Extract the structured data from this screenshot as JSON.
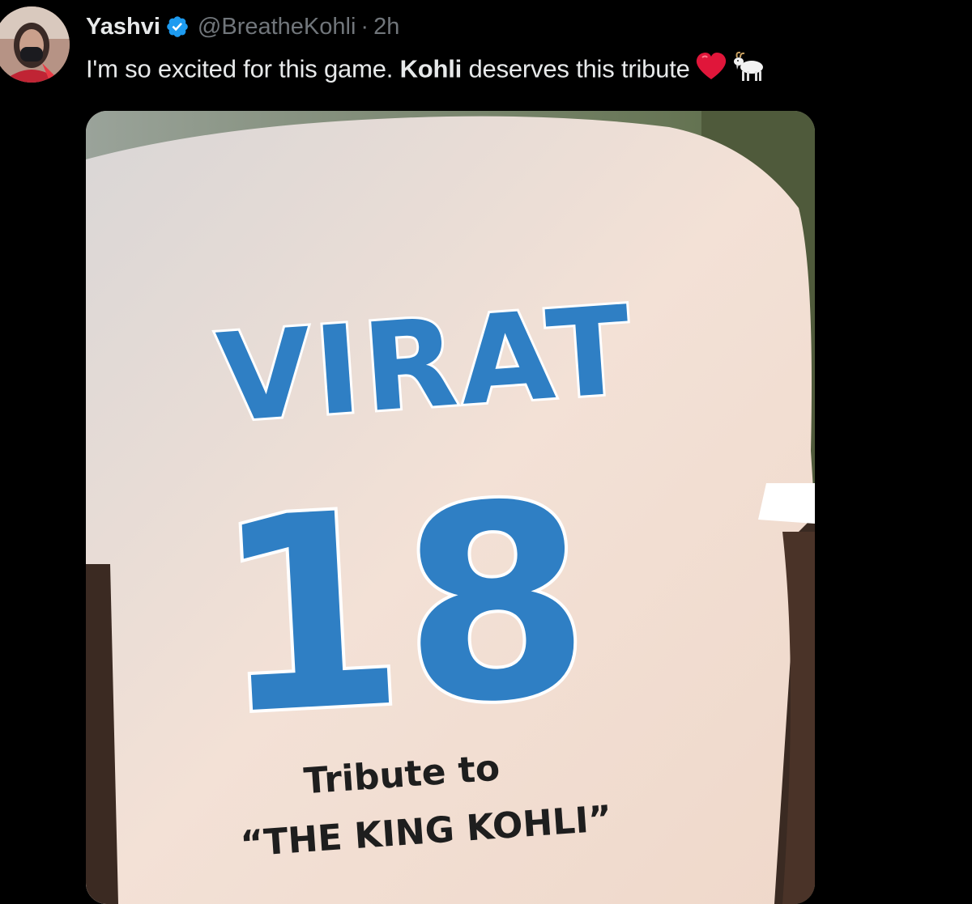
{
  "tweet": {
    "author": {
      "display_name": "Yashvi",
      "handle": "@BreatheKohli",
      "separator": "·",
      "time": "2h",
      "verified": true,
      "avatar_icon": "profile-avatar"
    },
    "text": {
      "part1": "I'm so excited for this game. ",
      "bold": "Kohli",
      "part2": " deserves this tribute",
      "emojis": [
        "red-heart-icon",
        "goat-icon"
      ]
    },
    "media": {
      "type": "photo",
      "shirt_name": "VIRAT",
      "shirt_number": "18",
      "tribute_line_1": "Tribute to",
      "tribute_line_2": "“THE KING KOHLI”"
    }
  },
  "colors": {
    "background": "#000000",
    "text_primary": "#e7e9ea",
    "text_secondary": "#71767b",
    "verified": "#1d9bf0",
    "jersey_blue": "#2f7fc4",
    "heart": "#f91880"
  }
}
